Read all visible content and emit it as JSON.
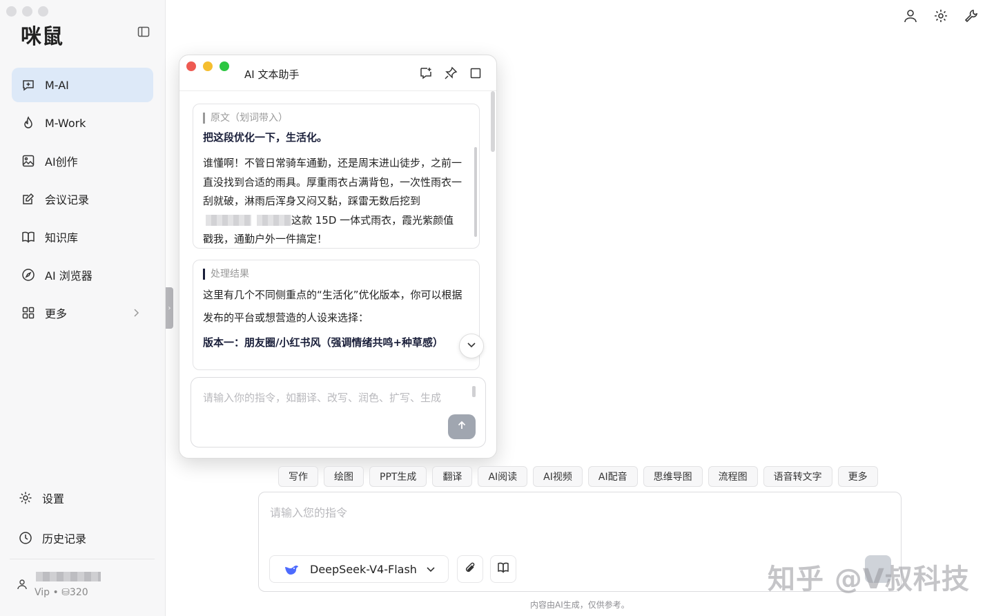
{
  "app": {
    "logo": "咪鼠"
  },
  "sidebar": {
    "items": [
      {
        "label": "M-AI",
        "icon": "chat-plus-icon",
        "active": true
      },
      {
        "label": "M-Work",
        "icon": "flame-icon"
      },
      {
        "label": "AI创作",
        "icon": "image-icon"
      },
      {
        "label": "会议记录",
        "icon": "edit-icon"
      },
      {
        "label": "知识库",
        "icon": "book-icon"
      },
      {
        "label": "AI 浏览器",
        "icon": "compass-icon"
      },
      {
        "label": "更多",
        "icon": "grid-icon"
      }
    ],
    "bottom": [
      {
        "label": "设置",
        "icon": "gear-icon"
      },
      {
        "label": "历史记录",
        "icon": "clock-icon"
      }
    ],
    "user": {
      "meta": "Vip  •  ⛁320"
    }
  },
  "popup": {
    "title": "AI 文本助手",
    "original": {
      "label": "原文（划词带入）",
      "instruction": "把这段优化一下，生活化。",
      "text_a": "谁懂啊！不管日常骑车通勤，还是周末进山徒步，之前一直没找到合适的雨具。厚重雨衣占满背包，一次性雨衣一刮就破，淋雨后浑身又闷又黏，踩雷无数后挖到",
      "text_b": "这款 15D 一体式雨衣，霞光紫颜值戳我，通勤户外一件搞定！"
    },
    "result": {
      "label": "处理结果",
      "text": "这里有几个不同侧重点的“生活化”优化版本，你可以根据发布的平台或想营造的人设来选择：",
      "version_title": "版本一：朋友圈/小红书风（强调情绪共鸣+种草感）"
    },
    "input_placeholder": "请输入你的指令，如翻译、改写、润色、扩写、生成"
  },
  "tools": [
    "写作",
    "绘图",
    "PPT生成",
    "翻译",
    "AI阅读",
    "AI视频",
    "AI配音",
    "思维导图",
    "流程图",
    "语音转文字",
    "更多"
  ],
  "composer": {
    "placeholder": "请输入您的指令",
    "model": "DeepSeek-V4-Flash"
  },
  "disclaimer": "内容由AI生成，仅供参考。",
  "watermark": "知乎 @V叔科技",
  "colors": {
    "active_bg": "#dde9f8",
    "close": "#ee5a52",
    "min": "#f5be2f",
    "max": "#2cc641",
    "accent": "#1a1f3a"
  }
}
